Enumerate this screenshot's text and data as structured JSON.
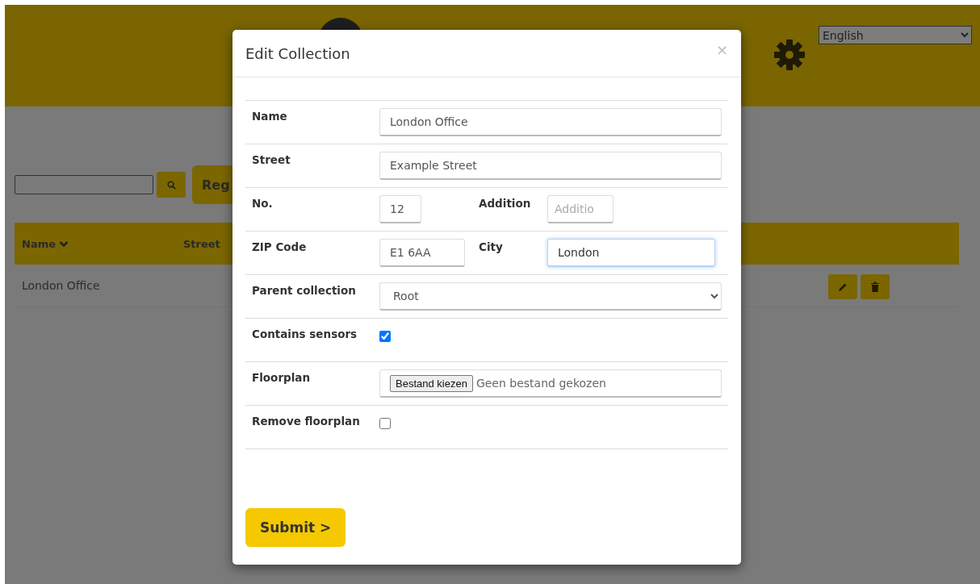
{
  "header": {
    "language": "English"
  },
  "toolbar": {
    "register_button": "Reg"
  },
  "table": {
    "columns": [
      {
        "label": "Name",
        "sorted": true
      },
      {
        "label": "Street",
        "sorted": false
      }
    ],
    "rows": [
      {
        "name": "London Office"
      }
    ]
  },
  "modal": {
    "title": "Edit Collection",
    "close": "×",
    "rows": [
      {
        "fields": [
          {
            "label": "Name",
            "kind": "text",
            "value": "London Office",
            "focused": false
          }
        ]
      },
      {
        "fields": [
          {
            "label": "Street",
            "kind": "text",
            "value": "Example Street",
            "focused": false
          }
        ]
      },
      {
        "fields": [
          {
            "label": "No.",
            "kind": "short",
            "value": "12",
            "focused": false
          },
          {
            "label": "Addition",
            "kind": "compact",
            "placeholder": "Additio",
            "focused": false
          }
        ]
      },
      {
        "fields": [
          {
            "label": "ZIP Code",
            "kind": "medium",
            "value": "E1 6AA",
            "focused": false
          },
          {
            "label": "City",
            "kind": "text",
            "value": "London",
            "focused": true
          }
        ]
      },
      {
        "fields": [
          {
            "label": "Parent collection",
            "kind": "select",
            "value": "Root"
          }
        ]
      },
      {
        "fields": [
          {
            "label": "Contains sensors",
            "kind": "checkbox",
            "checked": true
          }
        ]
      },
      {
        "fields": [
          {
            "label": "Floorplan",
            "kind": "file",
            "button": "Bestand kiezen",
            "status": "Geen bestand gekozen"
          }
        ]
      },
      {
        "fields": [
          {
            "label": "Remove floorplan",
            "kind": "checkbox",
            "checked": false
          }
        ]
      }
    ],
    "submit": "Submit >"
  }
}
